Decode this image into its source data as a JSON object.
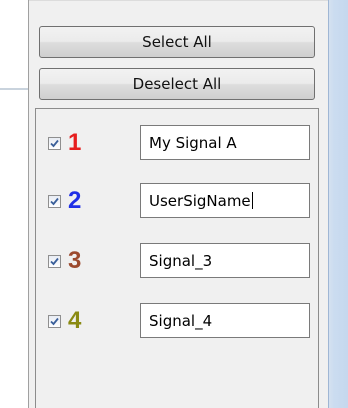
{
  "buttons": {
    "select_all": "Select All",
    "deselect_all": "Deselect All"
  },
  "signals": [
    {
      "checked": true,
      "number": "1",
      "color": "#e61e1e",
      "name": "My Signal A"
    },
    {
      "checked": true,
      "number": "2",
      "color": "#1f2fe6",
      "name": "UserSigName"
    },
    {
      "checked": true,
      "number": "3",
      "color": "#9c4a2e",
      "name": "Signal_3"
    },
    {
      "checked": true,
      "number": "4",
      "color": "#8a8a12",
      "name": "Signal_4"
    }
  ],
  "focused_field": 1
}
